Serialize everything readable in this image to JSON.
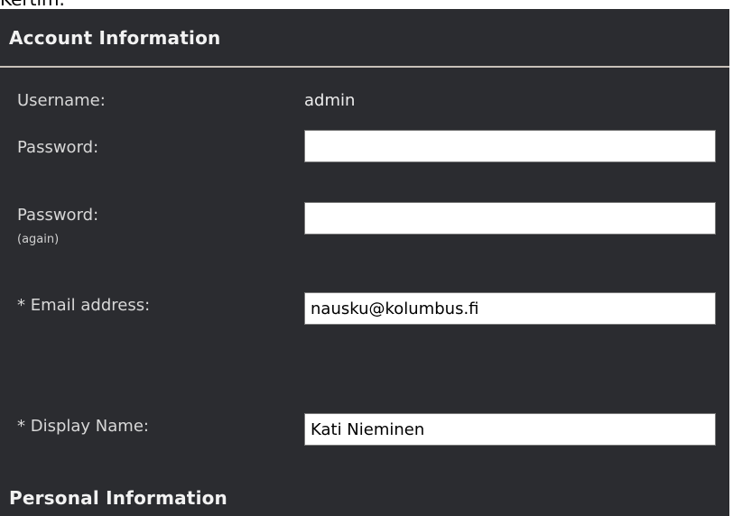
{
  "top_fragment": "Kertim.",
  "account_section": {
    "title": "Account Information",
    "username_label": "Username:",
    "username_value": "admin",
    "password_label": "Password:",
    "password_value": "",
    "password_again_label": "Password:",
    "password_again_note": "(again)",
    "password_again_value": "",
    "email_label": "* Email address:",
    "email_value": "nausku@kolumbus.fi",
    "display_name_label": "* Display Name:",
    "display_name_value": "Kati Nieminen"
  },
  "personal_section": {
    "title": "Personal Information"
  }
}
